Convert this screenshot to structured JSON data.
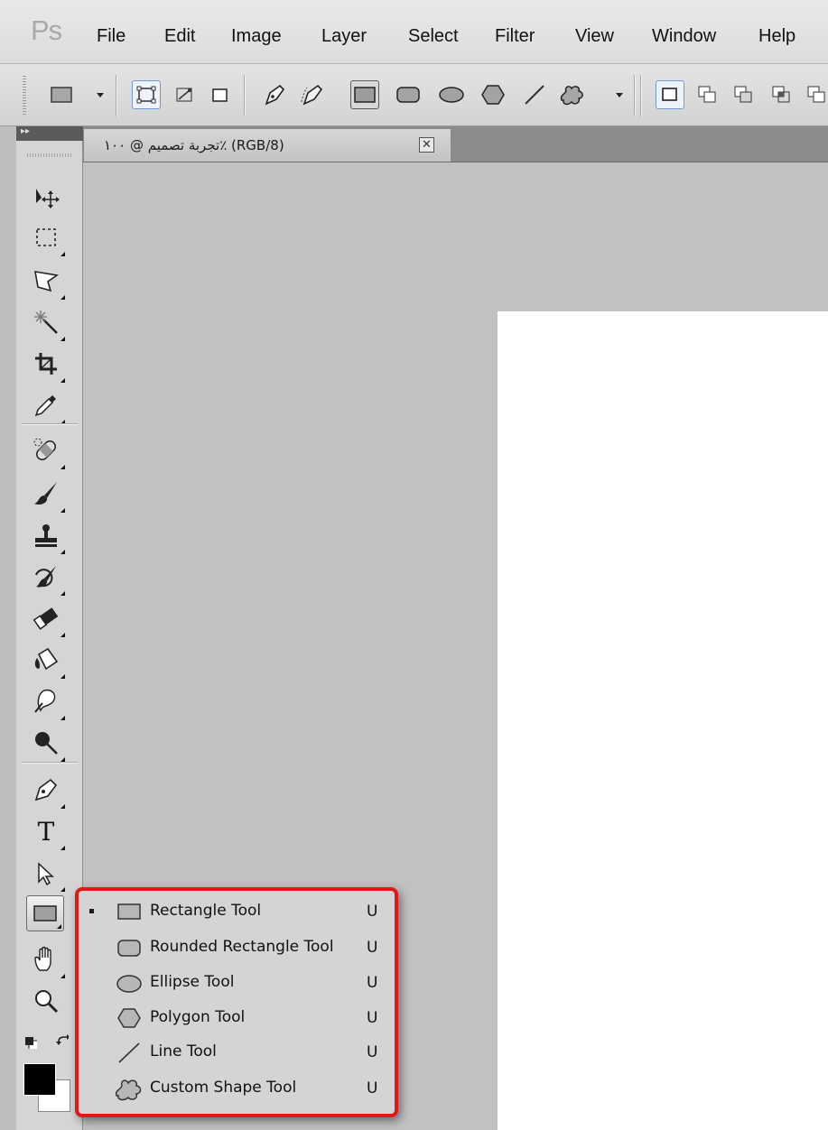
{
  "app": {
    "logo_text": "Ps",
    "menu": [
      "File",
      "Edit",
      "Image",
      "Layer",
      "Select",
      "Filter",
      "View",
      "Window",
      "Help"
    ]
  },
  "options_bar": {
    "tool_preset_icon": "rectangle-preset-icon",
    "mode_icons": [
      "shape-layers-icon",
      "paths-icon",
      "fill-pixels-icon"
    ],
    "shape_icons": [
      "pen-icon",
      "freeform-pen-icon",
      "rectangle-icon",
      "rounded-rectangle-icon",
      "ellipse-icon",
      "polygon-icon",
      "line-icon",
      "custom-shape-icon"
    ],
    "selected_shape": "rectangle-icon",
    "combine_icons": [
      "new-layer-icon",
      "add-icon",
      "subtract-icon",
      "intersect-icon"
    ]
  },
  "document": {
    "tab_title": "تجربة تصميم @ ١٠٠٪ (RGB/8)",
    "close_glyph": "✕"
  },
  "toolbox": {
    "collapse_glyph": "▸▸",
    "tools": [
      "move-tool-icon",
      "marquee-tool-icon",
      "lasso-tool-icon",
      "magic-wand-tool-icon",
      "crop-tool-icon",
      "eyedropper-tool-icon",
      "healing-brush-tool-icon",
      "brush-tool-icon",
      "clone-stamp-tool-icon",
      "history-brush-tool-icon",
      "eraser-tool-icon",
      "paint-bucket-tool-icon",
      "blur-tool-icon",
      "dodge-tool-icon",
      "pen-tool-icon",
      "type-tool-icon",
      "path-selection-tool-icon",
      "rectangle-tool-icon",
      "hand-tool-icon",
      "zoom-tool-icon"
    ],
    "type_tool_glyph": "T",
    "colors": {
      "foreground": "#000000",
      "background": "#ffffff"
    }
  },
  "flyout": {
    "highlight_color": "#e21818",
    "items": [
      {
        "label": "Rectangle Tool",
        "shortcut": "U",
        "icon": "rectangle-icon",
        "selected": true
      },
      {
        "label": "Rounded Rectangle Tool",
        "shortcut": "U",
        "icon": "rounded-rectangle-icon",
        "selected": false
      },
      {
        "label": "Ellipse Tool",
        "shortcut": "U",
        "icon": "ellipse-icon",
        "selected": false
      },
      {
        "label": "Polygon Tool",
        "shortcut": "U",
        "icon": "polygon-icon",
        "selected": false
      },
      {
        "label": "Line Tool",
        "shortcut": "U",
        "icon": "line-icon",
        "selected": false
      },
      {
        "label": "Custom Shape Tool",
        "shortcut": "U",
        "icon": "custom-shape-icon",
        "selected": false
      }
    ]
  }
}
